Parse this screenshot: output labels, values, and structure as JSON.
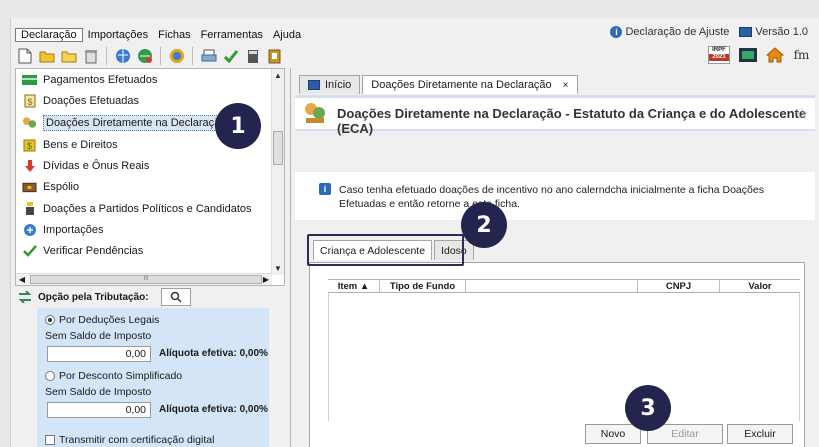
{
  "menu": {
    "items": [
      "Declaração",
      "Importações",
      "Fichas",
      "Ferramentas",
      "Ajuda"
    ],
    "right": {
      "declaration_type": "Declaração de Ajuste",
      "version": "Versão 1.0"
    }
  },
  "toolbar": {
    "irpf_label": "IRPF",
    "irpf_year": "2021"
  },
  "nav": {
    "items": [
      {
        "label": "Pagamentos Efetuados",
        "icon": "payments-icon"
      },
      {
        "label": "Doações Efetuadas",
        "icon": "donations-icon"
      },
      {
        "label": "Doações Diretamente na Declaração",
        "icon": "direct-donations-icon",
        "selected": true
      },
      {
        "label": "Bens e Direitos",
        "icon": "assets-icon"
      },
      {
        "label": "Dívidas e Ônus Reais",
        "icon": "debts-icon"
      },
      {
        "label": "Espólio",
        "icon": "estate-icon"
      },
      {
        "label": "Doações a Partidos Políticos e Candidatos",
        "icon": "political-donations-icon"
      },
      {
        "label": "Importações",
        "icon": "imports-icon"
      },
      {
        "label": "Verificar Pendências",
        "icon": "checkmark-icon"
      }
    ],
    "hscroll_grip": "III"
  },
  "tributacao": {
    "label": "Opção pela Tributação:",
    "option1": "Por Deduções Legais",
    "option1_sub": "Sem Saldo de Imposto",
    "option1_value": "0,00",
    "option1_aliq": "Alíquota efetiva: 0,00%",
    "option2": "Por Desconto Simplificado",
    "option2_sub": "Sem Saldo de Imposto",
    "option2_value": "0,00",
    "option2_aliq": "Alíquota efetiva: 0,00%",
    "transmit": "Transmitir com certificação digital"
  },
  "tabs": {
    "home": "Início",
    "current": "Doações Diretamente na Declaração",
    "close": "×"
  },
  "header": {
    "title": "Doações Diretamente na Declaração - Estatuto da Criança e do Adolescente (ECA)"
  },
  "info": {
    "text": "Caso tenha efetuado doações de incentivo no ano calernd​cha inicialmente a ficha Doações Efetuadas e então retorne a esta ficha."
  },
  "subtabs": [
    "Criança e Adolescente",
    "Idoso"
  ],
  "grid": {
    "columns": [
      "Item ▲",
      "Tipo de Fundo",
      "",
      "CNPJ",
      "Valor"
    ]
  },
  "buttons": {
    "new": "Novo",
    "edit": "Editar",
    "delete": "Excluir"
  },
  "badges": [
    "1",
    "2",
    "3"
  ]
}
